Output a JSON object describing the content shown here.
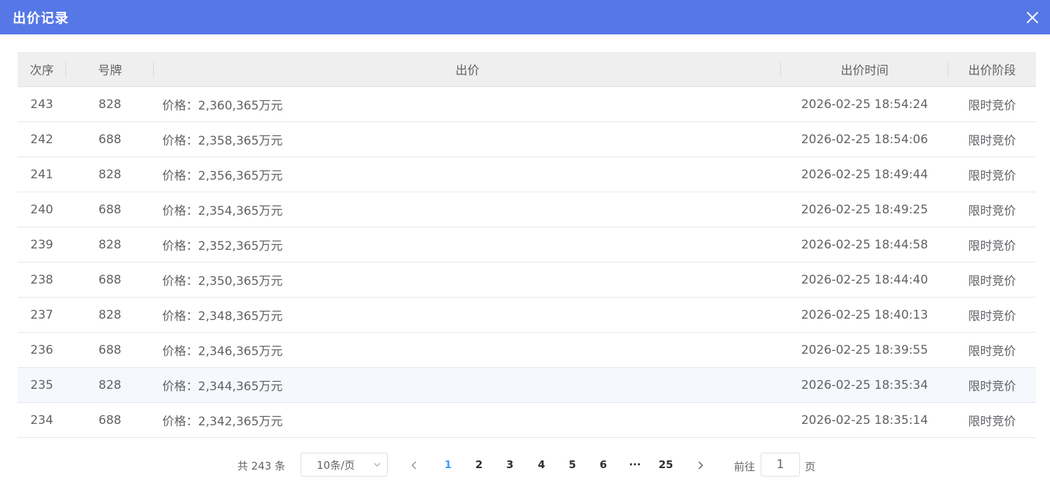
{
  "dialog": {
    "title": "出价记录"
  },
  "table": {
    "headers": [
      "次序",
      "号牌",
      "出价",
      "出价时间",
      "出价阶段"
    ],
    "rows": [
      [
        "243",
        "828",
        "价格：2,360,365万元",
        "2026-02-25 18:54:24",
        "限时竞价"
      ],
      [
        "242",
        "688",
        "价格：2,358,365万元",
        "2026-02-25 18:54:06",
        "限时竞价"
      ],
      [
        "241",
        "828",
        "价格：2,356,365万元",
        "2026-02-25 18:49:44",
        "限时竞价"
      ],
      [
        "240",
        "688",
        "价格：2,354,365万元",
        "2026-02-25 18:49:25",
        "限时竞价"
      ],
      [
        "239",
        "828",
        "价格：2,352,365万元",
        "2026-02-25 18:44:58",
        "限时竞价"
      ],
      [
        "238",
        "688",
        "价格：2,350,365万元",
        "2026-02-25 18:44:40",
        "限时竞价"
      ],
      [
        "237",
        "828",
        "价格：2,348,365万元",
        "2026-02-25 18:40:13",
        "限时竞价"
      ],
      [
        "236",
        "688",
        "价格：2,346,365万元",
        "2026-02-25 18:39:55",
        "限时竞价"
      ],
      [
        "235",
        "828",
        "价格：2,344,365万元",
        "2026-02-25 18:35:34",
        "限时竞价"
      ],
      [
        "234",
        "688",
        "价格：2,342,365万元",
        "2026-02-25 18:35:14",
        "限时竞价"
      ]
    ]
  },
  "pagination": {
    "total_text": "共 243 条",
    "page_size": "10条/页",
    "pages": [
      "1",
      "2",
      "3",
      "4",
      "5",
      "6",
      "···",
      "25"
    ],
    "current_page": "1",
    "goto_label": "前往",
    "goto_value": "1",
    "goto_suffix": "页"
  },
  "colors": {
    "header_bg": "#5677e6",
    "active_page": "#409eff"
  },
  "icons": {
    "close": "close-icon",
    "prev": "chevron-left-icon",
    "next": "chevron-right-icon",
    "dropdown": "chevron-down-icon"
  }
}
